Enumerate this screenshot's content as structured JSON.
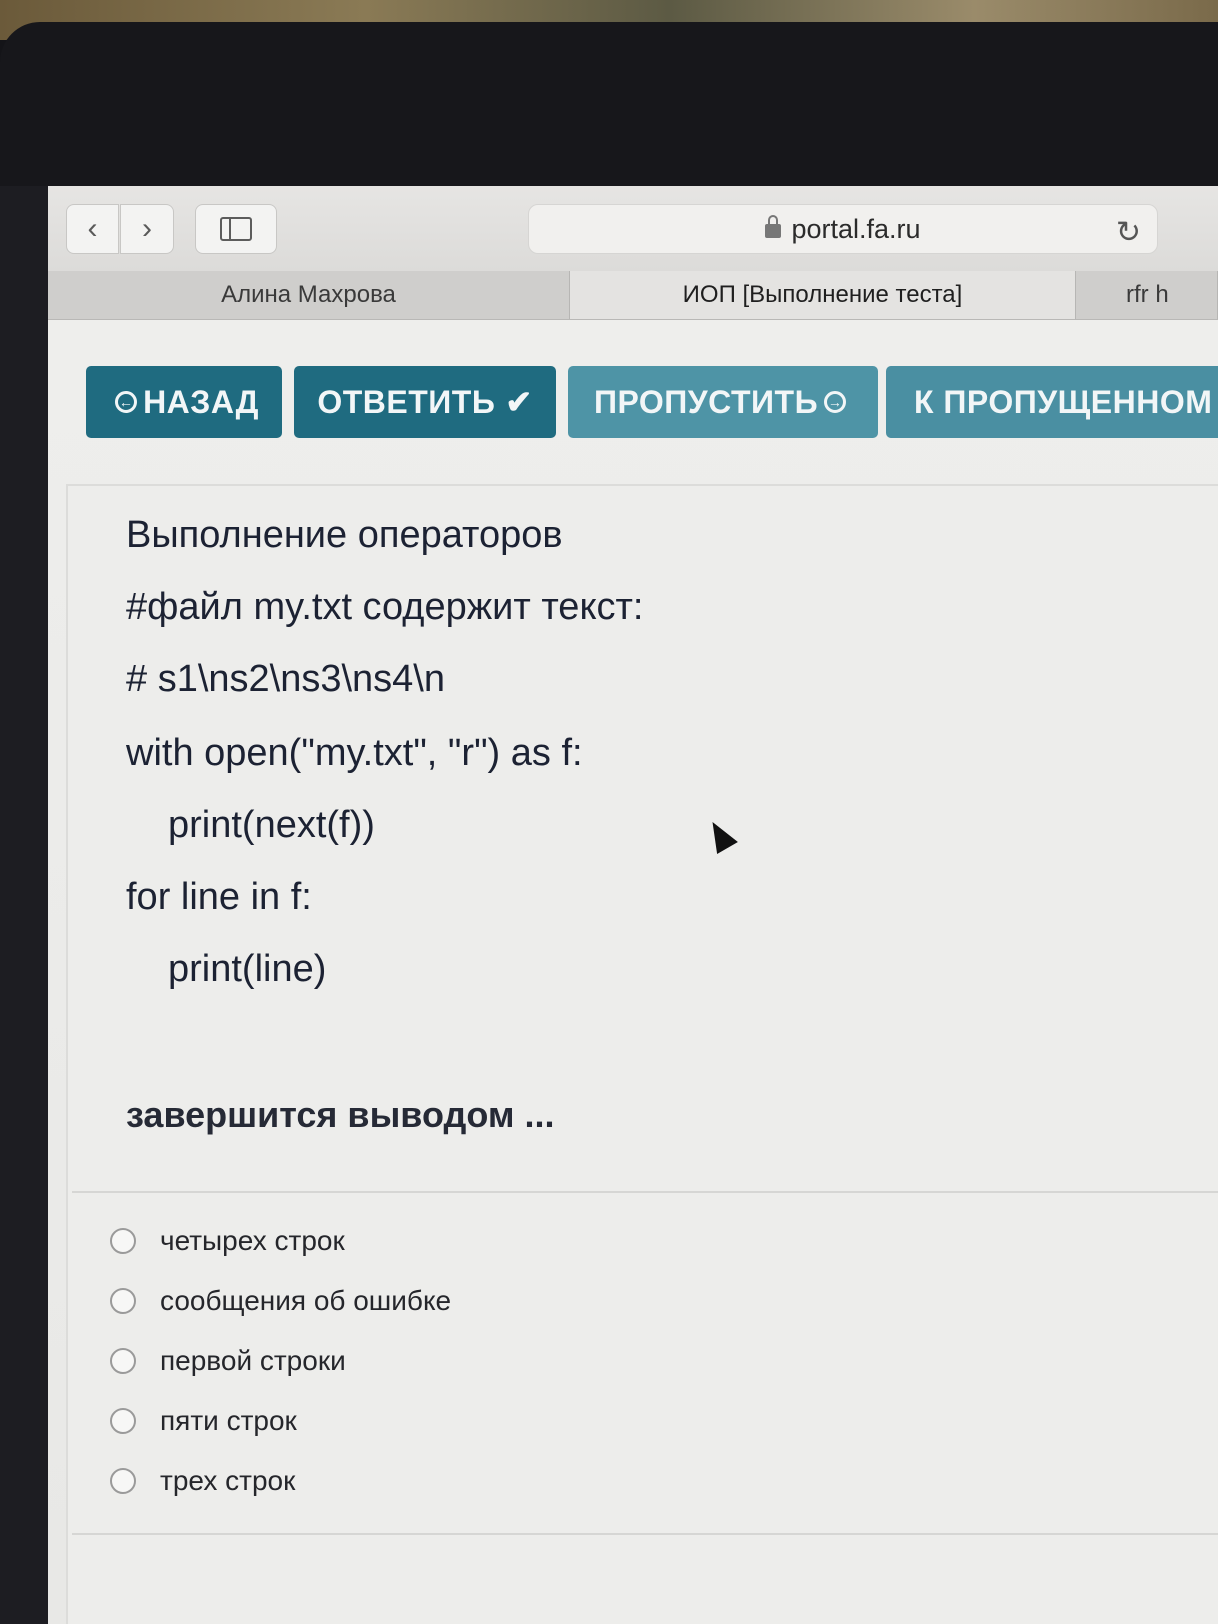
{
  "browser": {
    "back_icon": "chevron-left-icon",
    "forward_icon": "chevron-right-icon",
    "sidebar_icon": "sidebar-icon",
    "url": "portal.fa.ru",
    "reload_icon": "reload-icon"
  },
  "tabs": [
    {
      "label": "Алина Махрова"
    },
    {
      "label": "ИОП [Выполнение теста]"
    },
    {
      "label": "rfr h"
    }
  ],
  "actions": {
    "back_label": "НАЗАД",
    "answer_label": "ОТВЕТИТЬ",
    "skip_label": "ПРОПУСТИТЬ",
    "to_skipped_label": "К ПРОПУЩЕННОМ"
  },
  "question": {
    "lines": [
      "Выполнение операторов",
      "#файл my.txt содержит текст:",
      "# s1\\ns2\\ns3\\ns4\\n",
      "with open(\"my.txt\", \"r\") as f:",
      "print(next(f))",
      "for line in f:",
      "print(line)"
    ],
    "prompt": "завершится выводом ..."
  },
  "options": [
    {
      "label": "четырех строк"
    },
    {
      "label": "сообщения об ошибке"
    },
    {
      "label": "первой строки"
    },
    {
      "label": "пяти строк"
    },
    {
      "label": "трех строк"
    }
  ],
  "colors": {
    "primary_button": "#1f6b80",
    "secondary_button": "#4e94a6",
    "text": "#1c2233"
  }
}
